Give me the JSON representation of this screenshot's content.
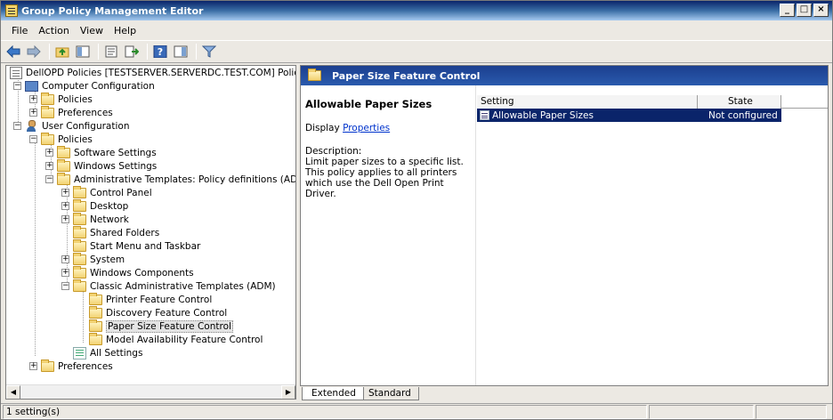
{
  "window": {
    "title": "Group Policy Management Editor",
    "controls": [
      "_",
      "□",
      "×"
    ]
  },
  "menu": [
    "File",
    "Action",
    "View",
    "Help"
  ],
  "toolbar": {
    "icons": [
      "back-icon",
      "forward-icon",
      "up-folder-icon",
      "show-hide-tree-icon",
      "properties-icon",
      "export-list-icon",
      "help-icon",
      "show-hide-action-pane-icon",
      "filter-icon"
    ]
  },
  "tree": {
    "root": "DellOPD Policies [TESTSERVER.SERVERDC.TEST.COM] Policy",
    "computer_configuration": "Computer Configuration",
    "cc_policies": "Policies",
    "cc_preferences": "Preferences",
    "user_configuration": "User Configuration",
    "uc_policies": "Policies",
    "software_settings": "Software Settings",
    "windows_settings": "Windows Settings",
    "admin_templates": "Administrative Templates: Policy definitions (ADMX files)",
    "control_panel": "Control Panel",
    "desktop": "Desktop",
    "network": "Network",
    "shared_folders": "Shared Folders",
    "start_menu": "Start Menu and Taskbar",
    "system": "System",
    "windows_components": "Windows Components",
    "classic_admin": "Classic Administrative Templates (ADM)",
    "printer_feature": "Printer Feature Control",
    "discovery_feature": "Discovery Feature Control",
    "paper_size_feature": "Paper Size Feature Control",
    "model_availability": "Model Availability Feature Control",
    "all_settings": "All Settings",
    "uc_preferences": "Preferences"
  },
  "right": {
    "header": "Paper Size Feature Control",
    "setting_title": "Allowable Paper Sizes",
    "display_label": "Display",
    "properties_link": "Properties",
    "description_label": "Description:",
    "description_text": "Limit paper sizes to a specific list.  This policy applies to all printers which use the Dell Open Print Driver.",
    "columns": [
      "Setting",
      "State"
    ],
    "rows": [
      {
        "setting": "Allowable Paper Sizes",
        "state": "Not configured"
      }
    ]
  },
  "tabs": [
    "Extended",
    "Standard"
  ],
  "status": {
    "text": "1 setting(s)"
  },
  "colors": {
    "selection": "#0a246a",
    "link": "#0033cc",
    "header_bg": "#1b3f8f"
  }
}
